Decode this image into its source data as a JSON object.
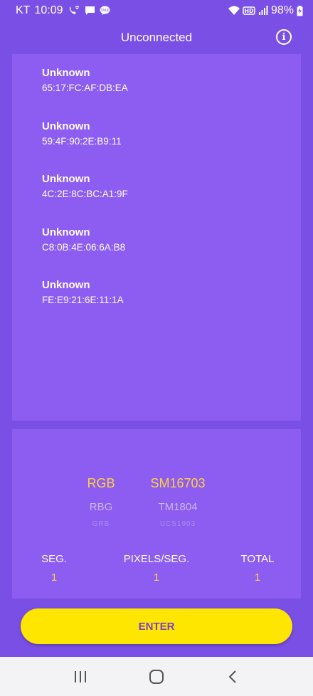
{
  "status_bar": {
    "carrier": "KT",
    "time": "10:09",
    "battery": "98%",
    "icons": [
      "wifi-calling-icon",
      "message-icon",
      "talk-icon",
      "wifi-icon",
      "hd-icon",
      "signal-icon",
      "battery-charging-icon"
    ]
  },
  "app_bar": {
    "title": "Unconnected",
    "info_icon": "info-icon"
  },
  "devices": [
    {
      "name": "Unknown",
      "mac": "65:17:FC:AF:DB:EA"
    },
    {
      "name": "Unknown",
      "mac": "59:4F:90:2E:B9:11"
    },
    {
      "name": "Unknown",
      "mac": "4C:2E:8C:BC:A1:9F"
    },
    {
      "name": "Unknown",
      "mac": "C8:0B:4E:06:6A:B8"
    },
    {
      "name": "Unknown",
      "mac": "FE:E9:21:6E:11:1A"
    }
  ],
  "color_order_picker": {
    "selected": "RGB",
    "options": [
      "RGB",
      "RBG",
      "GRB"
    ]
  },
  "ic_picker": {
    "selected": "SM16703",
    "options": [
      "SM16703",
      "TM1804",
      "UCS1903"
    ]
  },
  "stats": {
    "seg": {
      "label": "SEG.",
      "value": "1"
    },
    "pixels_per_seg": {
      "label": "PIXELS/SEG.",
      "value": "1"
    },
    "total": {
      "label": "TOTAL",
      "value": "1"
    }
  },
  "enter_label": "ENTER",
  "colors": {
    "background": "#7a4fe6",
    "panel": "#8d5cf0",
    "accent_yellow": "#ffd23f",
    "button_yellow": "#ffe600",
    "button_text": "#7a3fd0"
  },
  "nav_bar": {
    "icons": [
      "recent-apps-icon",
      "home-icon",
      "back-icon"
    ]
  }
}
